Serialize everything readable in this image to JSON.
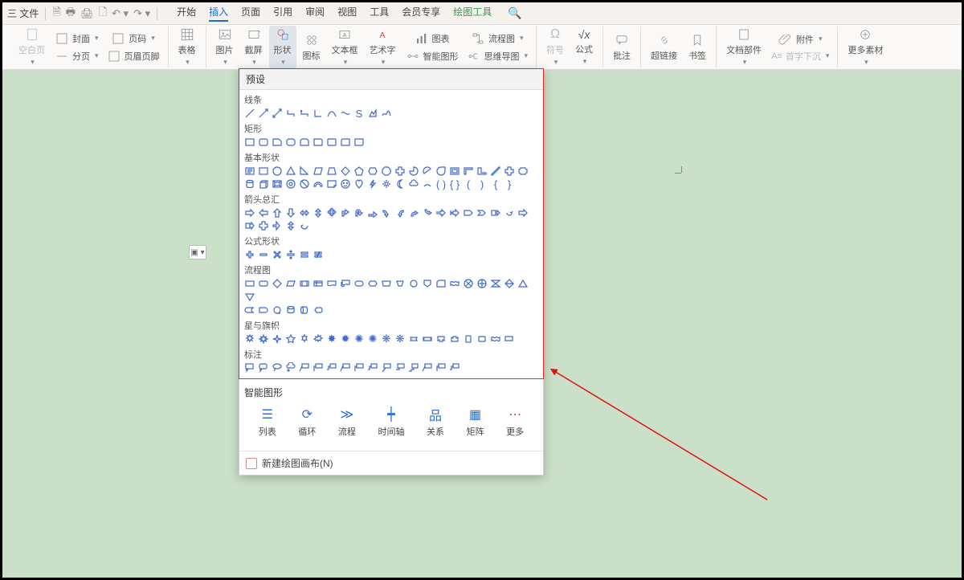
{
  "menubar": {
    "file_label": "三 文件",
    "tabs": [
      "开始",
      "插入",
      "页面",
      "引用",
      "审阅",
      "视图",
      "工具",
      "会员专享",
      "绘图工具"
    ],
    "active_tab": "插入",
    "green_tab": "绘图工具"
  },
  "ribbon": {
    "group1": {
      "blank_page": "空白页",
      "cover": "封面",
      "page_num": "页码",
      "section": "分页",
      "header_footer": "页眉页脚"
    },
    "group2": {
      "table": "表格"
    },
    "group3": {
      "picture": "图片",
      "screenshot": "截屏",
      "shapes": "形状",
      "icon": "图标",
      "textbox": "文本框",
      "wordart": "艺术字",
      "chart": "图表",
      "smartart": "智能图形",
      "flowchart": "流程图",
      "mindmap": "思维导图"
    },
    "group4": {
      "symbol": "符号",
      "equation": "公式"
    },
    "group5": {
      "comment": "批注"
    },
    "group6": {
      "hyperlink": "超链接",
      "bookmark": "书签"
    },
    "group7": {
      "docparts": "文档部件",
      "attachment": "附件",
      "capital": "首字下沉"
    },
    "group8": {
      "more": "更多素材"
    }
  },
  "shapes_panel": {
    "header": "预设",
    "categories": {
      "lines": "线条",
      "rects": "矩形",
      "basic": "基本形状",
      "arrows": "箭头总汇",
      "equation": "公式形状",
      "flow": "流程图",
      "stars": "星与旗帜",
      "callout": "标注"
    },
    "smart_title": "智能图形",
    "smart_items": [
      {
        "label": "列表"
      },
      {
        "label": "循环"
      },
      {
        "label": "流程"
      },
      {
        "label": "时间轴"
      },
      {
        "label": "关系"
      },
      {
        "label": "矩阵"
      },
      {
        "label": "更多"
      }
    ],
    "footer": "新建绘图画布(N)"
  }
}
